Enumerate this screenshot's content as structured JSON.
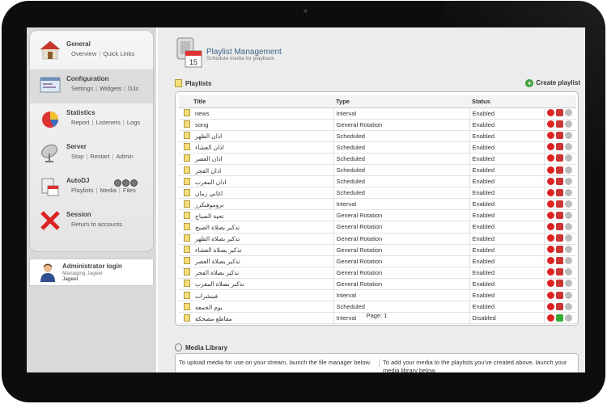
{
  "sidebar": {
    "items": [
      {
        "title": "General",
        "links": [
          "Overview",
          "Quick Links"
        ],
        "icon": "house-icon"
      },
      {
        "title": "Configuration",
        "links": [
          "Settings",
          "Widgets",
          "DJs"
        ],
        "icon": "config-window-icon"
      },
      {
        "title": "Statistics",
        "links": [
          "Report",
          "Listeners",
          "Logs"
        ],
        "icon": "pie-chart-icon"
      },
      {
        "title": "Server",
        "links": [
          "Stop",
          "Restart",
          "Admin"
        ],
        "icon": "satellite-dish-icon"
      },
      {
        "title": "AutoDJ",
        "links": [
          "Playlists",
          "Media",
          "Files"
        ],
        "icon": "autodj-playlist-icon"
      },
      {
        "title": "Session",
        "links": [
          "Return to accounts"
        ],
        "icon": "red-x-icon"
      }
    ],
    "admin": {
      "title": "Administrator login",
      "sub": "Managing Jageel",
      "name": "Jageel"
    }
  },
  "header": {
    "title": "Playlist Management",
    "subtitle": "Schedule media for playback"
  },
  "playlists": {
    "section_title": "Playlists",
    "create_label": "Create playlist",
    "columns": [
      "Title",
      "Type",
      "Status"
    ],
    "rows": [
      {
        "title": "news",
        "type": "Interval",
        "status": "Enabled"
      },
      {
        "title": "song",
        "type": "General Rotation",
        "status": "Enabled"
      },
      {
        "title": "اذان الظهر",
        "type": "Scheduled",
        "status": "Enabled"
      },
      {
        "title": "اذان العشاء",
        "type": "Scheduled",
        "status": "Enabled"
      },
      {
        "title": "اذان العصر",
        "type": "Scheduled",
        "status": "Enabled"
      },
      {
        "title": "اذان الفجر",
        "type": "Scheduled",
        "status": "Enabled"
      },
      {
        "title": "اذان المغرب",
        "type": "Scheduled",
        "status": "Enabled"
      },
      {
        "title": "اغاني زمان",
        "type": "Scheduled",
        "status": "Enabled"
      },
      {
        "title": "بروموفنكرر",
        "type": "Interval",
        "status": "Enabled"
      },
      {
        "title": "تحية الصباح",
        "type": "General Rotation",
        "status": "Enabled"
      },
      {
        "title": "تذكير بصلاة الصبح",
        "type": "General Rotation",
        "status": "Enabled"
      },
      {
        "title": "تذكير بصلاة الظهر",
        "type": "General Rotation",
        "status": "Enabled"
      },
      {
        "title": "تذكير بصلاة العشاء",
        "type": "General Rotation",
        "status": "Enabled"
      },
      {
        "title": "تذكير بصلاة العصر",
        "type": "General Rotation",
        "status": "Enabled"
      },
      {
        "title": "تذكير بصلاة الفجر",
        "type": "General Rotation",
        "status": "Enabled"
      },
      {
        "title": "تذكير بصلاة المغرب",
        "type": "General Rotation",
        "status": "Enabled"
      },
      {
        "title": "فينشرات",
        "type": "Interval",
        "status": "Enabled"
      },
      {
        "title": "يوم الجمعة",
        "type": "Scheduled",
        "status": "Enabled"
      },
      {
        "title": "مقاطع مضحكة",
        "type": "Interval",
        "status": "Disabled"
      }
    ],
    "page_label": "Page: 1"
  },
  "media": {
    "section_title": "Media Library",
    "left_text": "To upload media for use on your stream, launch the file manager below.",
    "right_text": "To add your media to the playlists you've created above, launch your media library below."
  },
  "colors": {
    "accent": "#3b5f86",
    "enabled_action": "#d22",
    "add": "#3aa03a"
  }
}
